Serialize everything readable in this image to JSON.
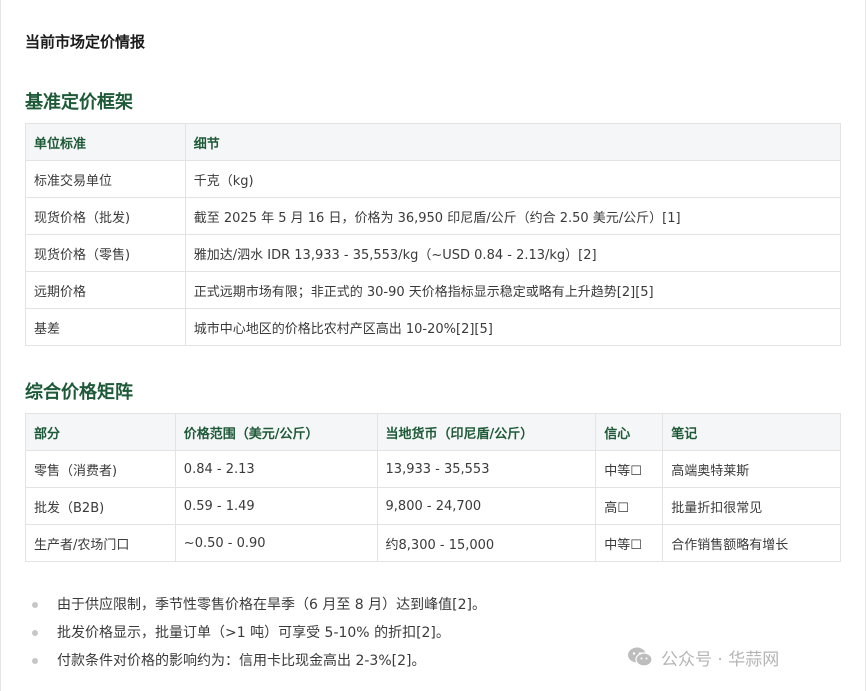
{
  "page_title": "当前市场定价情报",
  "section1": {
    "title": "基准定价框架",
    "headers": [
      "单位标准",
      "细节"
    ],
    "rows": [
      [
        "标准交易单位",
        "千克（kg)"
      ],
      [
        "现货价格（批发)",
        "截至 2025 年 5 月 16 日，价格为 36,950 印尼盾/公斤（约合 2.50 美元/公斤）[1]"
      ],
      [
        "现货价格（零售)",
        "雅加达/泗水 IDR 13,933 - 35,553/kg（~USD 0.84 - 2.13/kg）[2]"
      ],
      [
        "远期价格",
        "正式远期市场有限；非正式的 30-90 天价格指标显示稳定或略有上升趋势[2][5]"
      ],
      [
        "基差",
        "城市中心地区的价格比农村产区高出 10-20%[2][5]"
      ]
    ]
  },
  "section2": {
    "title": "综合价格矩阵",
    "headers": [
      "部分",
      "价格范围（美元/公斤）",
      "当地货币（印尼盾/公斤）",
      "信心",
      "笔记"
    ],
    "rows": [
      [
        "零售（消费者)",
        "0.84 - 2.13",
        "13,933 - 35,553",
        "中等☐",
        "高端奥特莱斯"
      ],
      [
        "批发（B2B)",
        "0.59 - 1.49",
        "9,800 - 24,700",
        "高☐",
        "批量折扣很常见"
      ],
      [
        "生产者/农场门口",
        "~0.50 - 0.90",
        "约8,300 - 15,000",
        "中等☐",
        "合作销售额略有增长"
      ]
    ]
  },
  "notes": [
    "由于供应限制，季节性零售价格在旱季（6 月至 8 月）达到峰值[2]。",
    "批发价格显示，批量订单（>1 吨）可享受 5-10% 的折扣[2]。",
    "付款条件对价格的影响约为：信用卡比现金高出 2-3%[2]。"
  ],
  "watermark": {
    "text": "公众号 · 华蒜网",
    "icon": "wechat-icon"
  }
}
